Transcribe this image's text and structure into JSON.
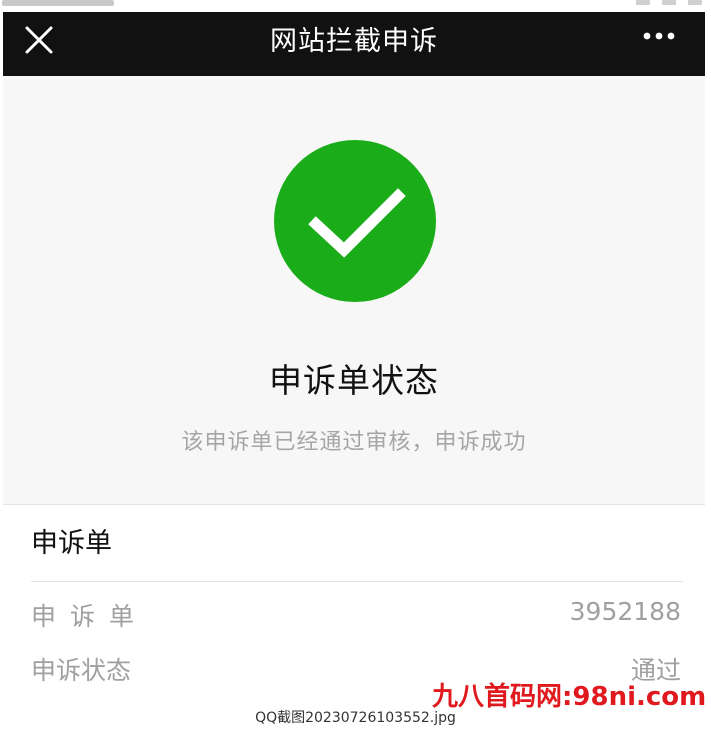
{
  "header": {
    "title": "网站拦截申诉",
    "close_icon": "close-icon",
    "more_icon": "more-dots-icon"
  },
  "status": {
    "icon": "checkmark-circle-icon",
    "icon_color": "#1aad19",
    "title": "申诉单状态",
    "description": "该申诉单已经通过审核，申诉成功"
  },
  "appeal_card": {
    "title": "申诉单",
    "rows": [
      {
        "label": "申诉单",
        "value": "3952188"
      },
      {
        "label": "申诉状态",
        "value": "通过"
      }
    ]
  },
  "watermark": {
    "text": "九八首码网:98ni.com",
    "color": "#e0191e"
  },
  "caption": "QQ截图20230726103552.jpg",
  "colors": {
    "titlebar": "#111111",
    "accent_green": "#1aad19",
    "muted_text": "#a6a6a6"
  }
}
